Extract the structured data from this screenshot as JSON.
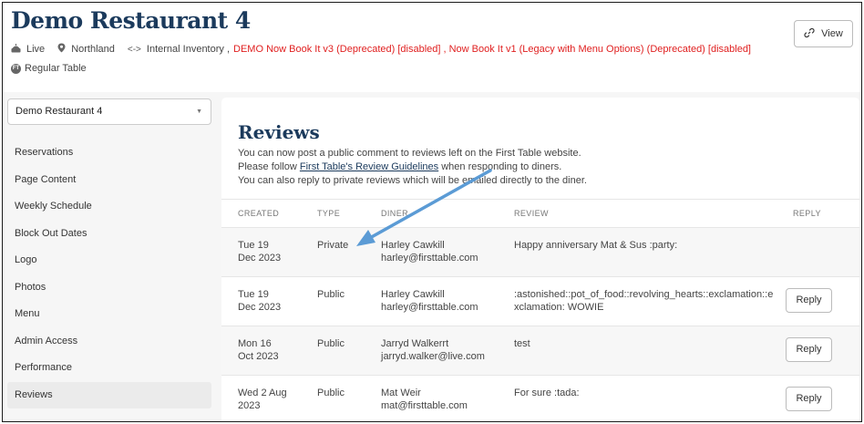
{
  "header": {
    "title": "Demo Restaurant 4",
    "status": "Live",
    "region": "Northland",
    "integrations_prefix": "Internal Inventory ,",
    "integrations_deprecated": "DEMO Now Book It v3 (Deprecated) [disabled] , Now Book It v1 (Legacy with Menu Options) (Deprecated) [disabled]",
    "table_type": "Regular Table",
    "view_label": "View"
  },
  "sidebar": {
    "selected_restaurant": "Demo Restaurant 4",
    "items": [
      {
        "label": "Reservations"
      },
      {
        "label": "Page Content"
      },
      {
        "label": "Weekly Schedule"
      },
      {
        "label": "Block Out Dates"
      },
      {
        "label": "Logo"
      },
      {
        "label": "Photos"
      },
      {
        "label": "Menu"
      },
      {
        "label": "Admin Access"
      },
      {
        "label": "Performance"
      },
      {
        "label": "Reviews"
      }
    ]
  },
  "main": {
    "title": "Reviews",
    "desc_line1": "You can now post a public comment to reviews left on the First Table website.",
    "desc_line2_pre": "Please follow ",
    "desc_line2_link": "First Table's Review Guidelines",
    "desc_line2_post": " when responding to diners.",
    "desc_line3": "You can also reply to private reviews which will be emailed directly to the diner.",
    "columns": {
      "created": "CREATED",
      "type": "TYPE",
      "diner": "DINER",
      "review": "REVIEW",
      "reply": "REPLY"
    },
    "reply_label": "Reply",
    "rows": [
      {
        "created_1": "Tue 19",
        "created_2": "Dec 2023",
        "type": "Private",
        "diner_name": "Harley Cawkill",
        "diner_email": "harley@firsttable.com",
        "review": "Happy anniversary Mat & Sus :party:"
      },
      {
        "created_1": "Tue 19",
        "created_2": "Dec 2023",
        "type": "Public",
        "diner_name": "Harley Cawkill",
        "diner_email": "harley@firsttable.com",
        "review": ":astonished::pot_of_food::revolving_hearts::exclamation::exclamation: WOWIE"
      },
      {
        "created_1": "Mon 16",
        "created_2": "Oct 2023",
        "type": "Public",
        "diner_name": "Jarryd Walkerrt",
        "diner_email": "jarryd.walker@live.com",
        "review": "test"
      },
      {
        "created_1": "Wed 2 Aug",
        "created_2": "2023",
        "type": "Public",
        "diner_name": "Mat Weir",
        "diner_email": "mat@firsttable.com",
        "review": "For sure :tada:"
      }
    ]
  },
  "colors": {
    "brand_navy": "#1b3a5c",
    "deprecated_red": "#e02020",
    "annotation_arrow": "#5b9bd5"
  }
}
